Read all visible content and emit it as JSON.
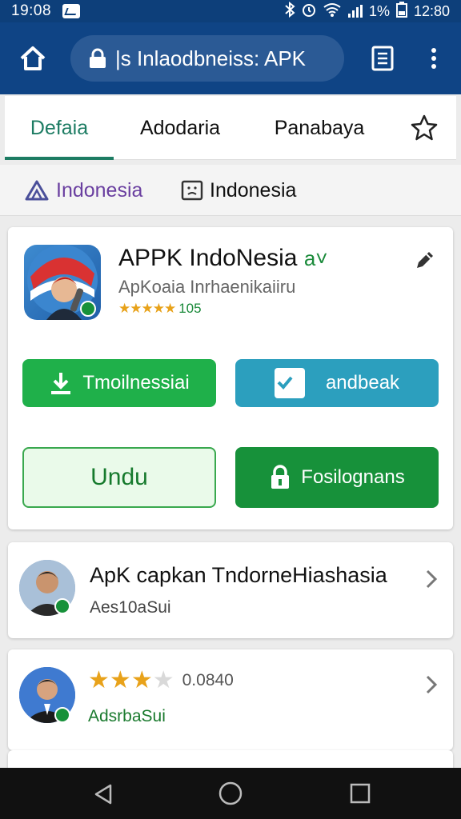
{
  "status_bar": {
    "time": "19:08",
    "battery": "1%",
    "clock_right": "12:80"
  },
  "browser": {
    "url_text": "|s Inlaodbneiss: APK"
  },
  "tabs": [
    {
      "label": "Defaia",
      "active": true
    },
    {
      "label": "Adodaria",
      "active": false
    },
    {
      "label": "Panabaya",
      "active": false
    }
  ],
  "chips": [
    {
      "label": "Indonesia",
      "icon": "triangle-logo-icon"
    },
    {
      "label": "Indonesia",
      "icon": "sad-face-box-icon"
    }
  ],
  "app_card": {
    "title": "APPK IndoNesia",
    "verified_mark": "a˅",
    "subtitle": "ApKoaia Inrhaenikaiiru",
    "stars": "★★★★★",
    "rating_count": "105",
    "buttons": {
      "download": "Tmoilnessiai",
      "teal": "andbeak",
      "outline": "Undu",
      "green": "Fosilognans"
    }
  },
  "list_items": [
    {
      "title": "ApK capkan TndorneHiashasia",
      "subtitle": "Aes10aSui"
    },
    {
      "rating_value": "0.0840",
      "stars_filled": 3,
      "stars_total": 5,
      "subtitle": "AdsrbaSui"
    }
  ],
  "colors": {
    "status_bar": "#0d3f7a",
    "app_bar": "#0f4485",
    "accent_tab": "#1d7c63",
    "download_green": "#1fb04a",
    "teal": "#2c9fbe",
    "dark_green": "#17913a",
    "star": "#e8a21a"
  }
}
